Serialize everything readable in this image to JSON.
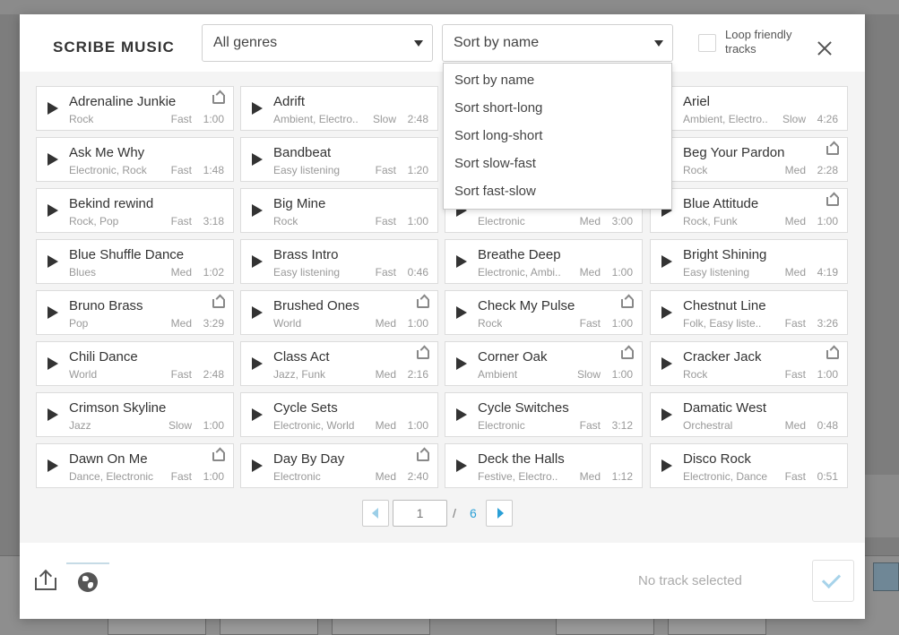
{
  "header": {
    "title": "SCRIBE MUSIC",
    "genre_select": "All genres",
    "sort_select": "Sort by name",
    "loop_label": "Loop friendly tracks"
  },
  "sort_options": [
    "Sort by name",
    "Sort short-long",
    "Sort long-short",
    "Sort slow-fast",
    "Sort fast-slow"
  ],
  "tracks": [
    {
      "name": "Adrenaline Junkie",
      "genre": "Rock",
      "speed": "Fast",
      "duration": "1:00",
      "loop": true
    },
    {
      "name": "Adrift",
      "genre": "Ambient, Electro..",
      "speed": "Slow",
      "duration": "2:48",
      "loop": false
    },
    {
      "name": "",
      "genre": "",
      "speed": "",
      "duration": "",
      "loop": false
    },
    {
      "name": "Ariel",
      "genre": "Ambient, Electro..",
      "speed": "Slow",
      "duration": "4:26",
      "loop": false
    },
    {
      "name": "Ask Me Why",
      "genre": "Electronic, Rock",
      "speed": "Fast",
      "duration": "1:48",
      "loop": false
    },
    {
      "name": "Bandbeat",
      "genre": "Easy listening",
      "speed": "Fast",
      "duration": "1:20",
      "loop": false
    },
    {
      "name": "",
      "genre": "",
      "speed": "",
      "duration": "",
      "loop": false
    },
    {
      "name": "Beg Your Pardon",
      "genre": "Rock",
      "speed": "Med",
      "duration": "2:28",
      "loop": true
    },
    {
      "name": "Bekind rewind",
      "genre": "Rock, Pop",
      "speed": "Fast",
      "duration": "3:18",
      "loop": false
    },
    {
      "name": "Big Mine",
      "genre": "Rock",
      "speed": "Fast",
      "duration": "1:00",
      "loop": false
    },
    {
      "name": "",
      "genre": "Electronic",
      "speed": "Med",
      "duration": "3:00",
      "loop": false
    },
    {
      "name": "Blue Attitude",
      "genre": "Rock, Funk",
      "speed": "Med",
      "duration": "1:00",
      "loop": true
    },
    {
      "name": "Blue Shuffle Dance",
      "genre": "Blues",
      "speed": "Med",
      "duration": "1:02",
      "loop": false
    },
    {
      "name": "Brass Intro",
      "genre": "Easy listening",
      "speed": "Fast",
      "duration": "0:46",
      "loop": false
    },
    {
      "name": "Breathe Deep",
      "genre": "Electronic, Ambi..",
      "speed": "Med",
      "duration": "1:00",
      "loop": false
    },
    {
      "name": "Bright Shining",
      "genre": "Easy listening",
      "speed": "Med",
      "duration": "4:19",
      "loop": false
    },
    {
      "name": "Bruno Brass",
      "genre": "Pop",
      "speed": "Med",
      "duration": "3:29",
      "loop": true
    },
    {
      "name": "Brushed Ones",
      "genre": "World",
      "speed": "Med",
      "duration": "1:00",
      "loop": true
    },
    {
      "name": "Check My Pulse",
      "genre": "Rock",
      "speed": "Fast",
      "duration": "1:00",
      "loop": true
    },
    {
      "name": "Chestnut Line",
      "genre": "Folk, Easy liste..",
      "speed": "Fast",
      "duration": "3:26",
      "loop": false
    },
    {
      "name": "Chili Dance",
      "genre": "World",
      "speed": "Fast",
      "duration": "2:48",
      "loop": false
    },
    {
      "name": "Class Act",
      "genre": "Jazz, Funk",
      "speed": "Med",
      "duration": "2:16",
      "loop": true
    },
    {
      "name": "Corner Oak",
      "genre": "Ambient",
      "speed": "Slow",
      "duration": "1:00",
      "loop": true
    },
    {
      "name": "Cracker Jack",
      "genre": "Rock",
      "speed": "Fast",
      "duration": "1:00",
      "loop": true
    },
    {
      "name": "Crimson Skyline",
      "genre": "Jazz",
      "speed": "Slow",
      "duration": "1:00",
      "loop": false
    },
    {
      "name": "Cycle Sets",
      "genre": "Electronic, World",
      "speed": "Med",
      "duration": "1:00",
      "loop": false
    },
    {
      "name": "Cycle Switches",
      "genre": "Electronic",
      "speed": "Fast",
      "duration": "3:12",
      "loop": false
    },
    {
      "name": "Damatic West",
      "genre": "Orchestral",
      "speed": "Med",
      "duration": "0:48",
      "loop": false
    },
    {
      "name": "Dawn On Me",
      "genre": "Dance, Electronic",
      "speed": "Fast",
      "duration": "1:00",
      "loop": true
    },
    {
      "name": "Day By Day",
      "genre": "Electronic",
      "speed": "Med",
      "duration": "2:40",
      "loop": true
    },
    {
      "name": "Deck the Halls",
      "genre": "Festive, Electro..",
      "speed": "Med",
      "duration": "1:12",
      "loop": false
    },
    {
      "name": "Disco Rock",
      "genre": "Electronic, Dance",
      "speed": "Fast",
      "duration": "0:51",
      "loop": false
    }
  ],
  "pagination": {
    "current": "1",
    "separator": "/",
    "total": "6"
  },
  "footer": {
    "status": "No track selected"
  },
  "colors": {
    "accent": "#2a9fd6",
    "confirm": "#a7d3ea"
  },
  "icons": [
    "upload-icon",
    "globe-icon",
    "close-icon",
    "checkmark-icon",
    "play-icon",
    "loop-icon"
  ]
}
